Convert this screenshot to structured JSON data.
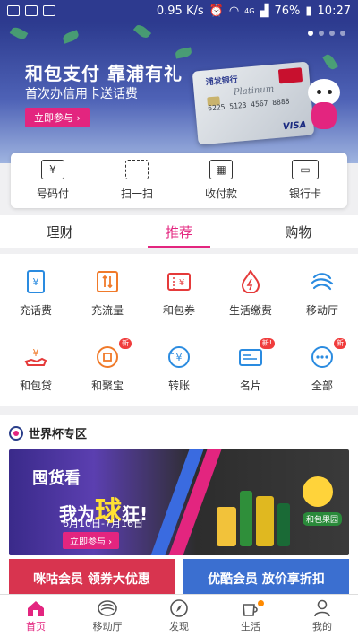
{
  "status_bar": {
    "speed": "0.95 K/s",
    "network": "4G",
    "battery": "76%",
    "time": "10:27"
  },
  "banner": {
    "title": "和包支付 靠浦有礼",
    "subtitle": "首次办信用卡送话费",
    "cta": "立即参与 ›",
    "card_bank": "浦发银行",
    "card_tier": "Platinum",
    "card_number": "6225 5123 4567 8888",
    "card_brand": "VISA",
    "slides": 4,
    "active_slide": 1
  },
  "quick_actions": [
    {
      "label": "号码付",
      "icon": "phone-pay-icon"
    },
    {
      "label": "扫一扫",
      "icon": "scan-icon"
    },
    {
      "label": "收付款",
      "icon": "qr-code-icon"
    },
    {
      "label": "银行卡",
      "icon": "bank-card-icon"
    }
  ],
  "tabs": [
    {
      "label": "理财",
      "active": false
    },
    {
      "label": "推荐",
      "active": true
    },
    {
      "label": "购物",
      "active": false
    }
  ],
  "services": [
    {
      "label": "充话费",
      "icon": "phone-recharge-icon",
      "badge": ""
    },
    {
      "label": "充流量",
      "icon": "data-recharge-icon",
      "badge": ""
    },
    {
      "label": "和包券",
      "icon": "coupon-icon",
      "badge": ""
    },
    {
      "label": "生活缴费",
      "icon": "utility-icon",
      "badge": ""
    },
    {
      "label": "移动厅",
      "icon": "mobile-hall-icon",
      "badge": ""
    },
    {
      "label": "和包贷",
      "icon": "loan-icon",
      "badge": ""
    },
    {
      "label": "和聚宝",
      "icon": "treasure-icon",
      "badge": "新"
    },
    {
      "label": "转账",
      "icon": "transfer-icon",
      "badge": ""
    },
    {
      "label": "名片",
      "icon": "business-card-icon",
      "badge": "新!"
    },
    {
      "label": "全部",
      "icon": "more-icon",
      "badge": "新"
    }
  ],
  "world_cup": {
    "header": "世界杯专区",
    "promo_line1": "囤货看",
    "promo_line2a": "我为",
    "promo_line2b": "球",
    "promo_line2c": "狂!",
    "promo_dates": "6月10日-7月16日",
    "promo_cta": "立即参与 ›",
    "mascot_label": "和包果园",
    "card_left": "咪咕会员 领券大优惠",
    "card_right": "优酷会员 放价享折扣"
  },
  "bottom_nav": [
    {
      "label": "首页",
      "icon": "home-icon",
      "active": true,
      "dot": false
    },
    {
      "label": "移动厅",
      "icon": "mobile-hall-nav-icon",
      "active": false,
      "dot": false
    },
    {
      "label": "发现",
      "icon": "compass-icon",
      "active": false,
      "dot": false
    },
    {
      "label": "生活",
      "icon": "coffee-icon",
      "active": false,
      "dot": true
    },
    {
      "label": "我的",
      "icon": "user-icon",
      "active": false,
      "dot": false
    }
  ],
  "colors": {
    "accent": "#e3257f",
    "banner_dark": "#2c3a8e",
    "icon_blue": "#2a8be0",
    "icon_orange": "#f07a2a",
    "icon_red": "#e53a3a"
  }
}
